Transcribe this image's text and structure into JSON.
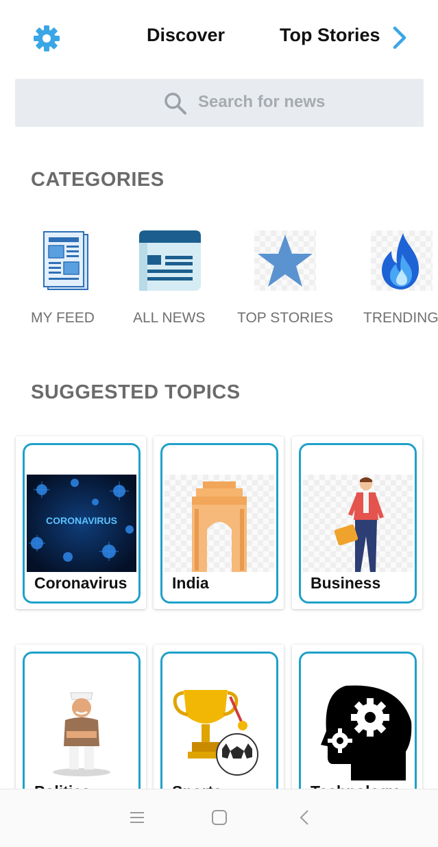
{
  "header": {
    "tabs": [
      "Discover",
      "Top Stories"
    ],
    "settings_icon": "gear-icon",
    "next_icon": "chevron-right-icon",
    "accent_color": "#3ba6e6"
  },
  "search": {
    "placeholder": "Search for news",
    "icon": "search-icon"
  },
  "categories": {
    "title": "CATEGORIES",
    "items": [
      {
        "label": "MY FEED",
        "icon": "newspaper-icon"
      },
      {
        "label": "ALL NEWS",
        "icon": "news-list-icon"
      },
      {
        "label": "TOP STORIES",
        "icon": "star-icon"
      },
      {
        "label": "TRENDING",
        "icon": "flame-icon"
      }
    ]
  },
  "topics": {
    "title": "SUGGESTED TOPICS",
    "items": [
      {
        "label": "Coronavirus",
        "image_text": "CORONAVIRUS"
      },
      {
        "label": "India"
      },
      {
        "label": "Business"
      },
      {
        "label": "Politics"
      },
      {
        "label": "Sports"
      },
      {
        "label": "Technology"
      }
    ],
    "border_color": "#1fa0c8"
  },
  "navbar": {
    "icons": [
      "menu-icon",
      "home-icon",
      "back-icon"
    ]
  }
}
